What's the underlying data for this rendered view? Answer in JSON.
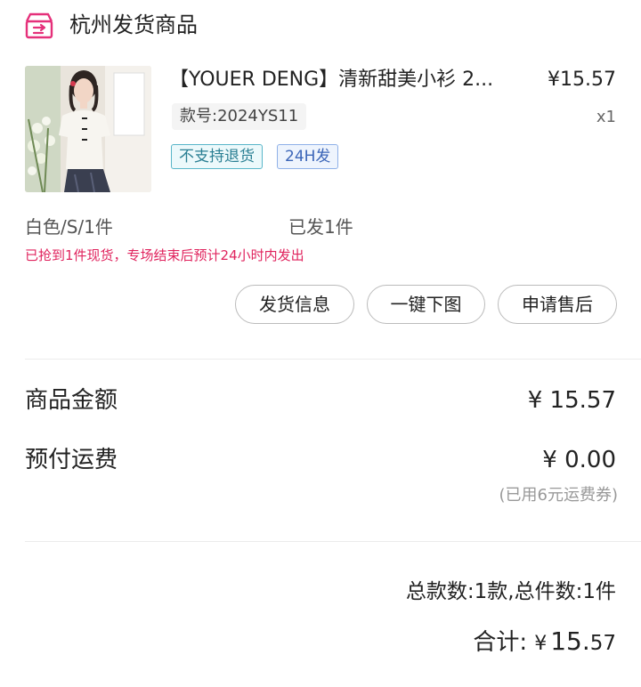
{
  "header": {
    "title": "杭州发货商品",
    "icon": "warehouse-icon",
    "icon_color": "#e5307a"
  },
  "product": {
    "title": "【YOUER DENG】清新甜美小衫  2...",
    "price": "¥15.57",
    "style_no": "款号:2024YS11",
    "quantity": "x1",
    "tags": [
      "不支持退货",
      "24H发"
    ],
    "variant": "白色/S/1件",
    "shipped": "已发1件",
    "notice": "已抢到1件现货，专场结束后预计24小时内发出"
  },
  "actions": {
    "shipping_info": "发货信息",
    "download_images": "一键下图",
    "after_sale": "申请售后"
  },
  "amounts": {
    "goods_label": "商品金额",
    "goods_value": "¥ 15.57",
    "freight_label": "预付运费",
    "freight_value": "¥ 0.00",
    "coupon_note": "(已用6元运费券)",
    "summary": "总款数:1款,总件数:1件",
    "total_label": "合计:",
    "total_currency": "¥",
    "total_int": "15.",
    "total_dec": "57"
  },
  "colors": {
    "accent": "#e0245e",
    "tag_noreturn": "#2a7f93",
    "tag_24h": "#3c66b8"
  }
}
